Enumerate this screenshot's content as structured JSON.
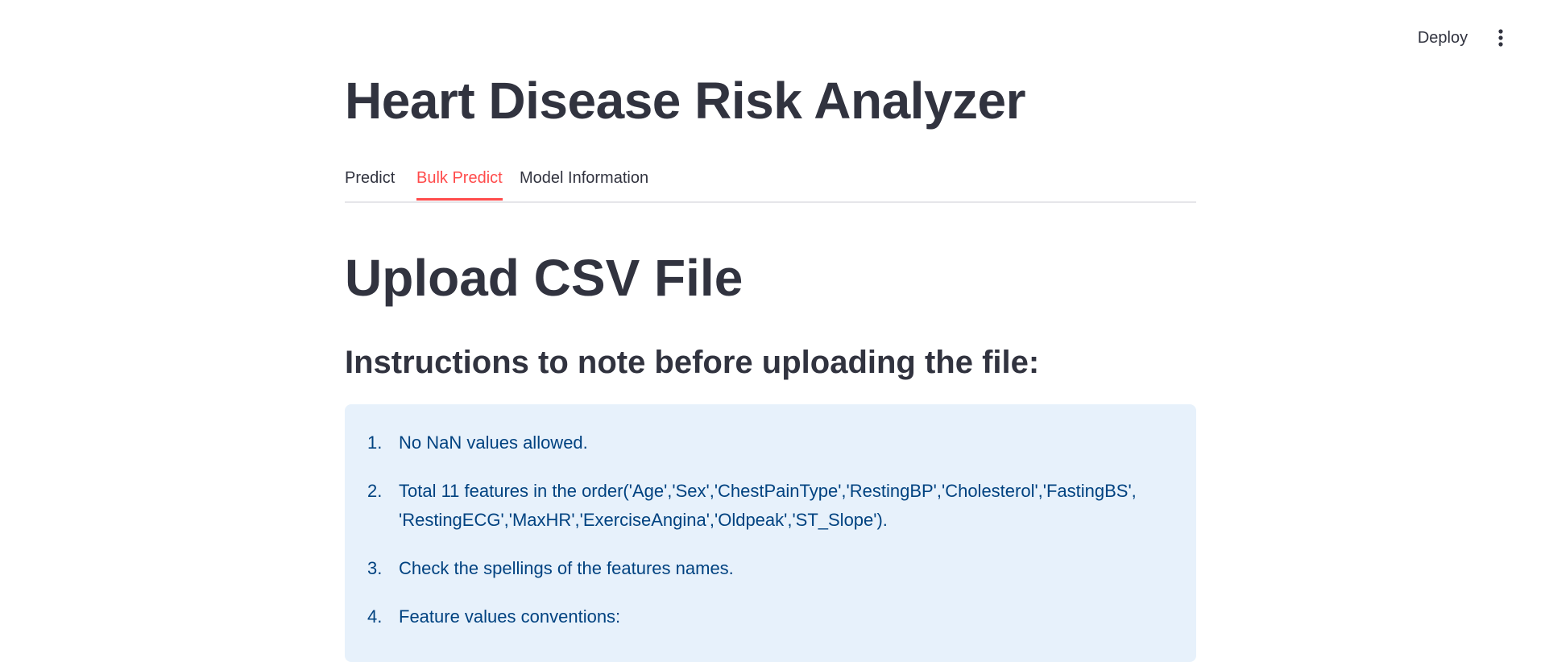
{
  "header": {
    "deploy_label": "Deploy",
    "menu_icon": "vertical-ellipsis-icon"
  },
  "app": {
    "title": "Heart Disease Risk Analyzer"
  },
  "tabs": [
    {
      "label": "Predict",
      "active": false
    },
    {
      "label": "Bulk Predict",
      "active": true
    },
    {
      "label": "Model Information",
      "active": false
    }
  ],
  "content": {
    "section_title": "Upload CSV File",
    "instructions_title": "Instructions to note before uploading the file:",
    "instructions": [
      {
        "num": "1.",
        "text": "No NaN values allowed."
      },
      {
        "num": "2.",
        "line1": "Total 11 features in the order('Age','Sex','ChestPainType','RestingBP','Cholesterol','FastingBS',",
        "line2": "'RestingECG','MaxHR','ExerciseAngina','Oldpeak','ST_Slope')."
      },
      {
        "num": "3.",
        "text": "Check the spellings of the features names."
      },
      {
        "num": "4.",
        "text": "Feature values conventions:"
      }
    ]
  },
  "colors": {
    "accent": "#ff4b4b",
    "text": "#31333f",
    "info_bg": "#e7f1fb",
    "info_text": "#004280"
  }
}
